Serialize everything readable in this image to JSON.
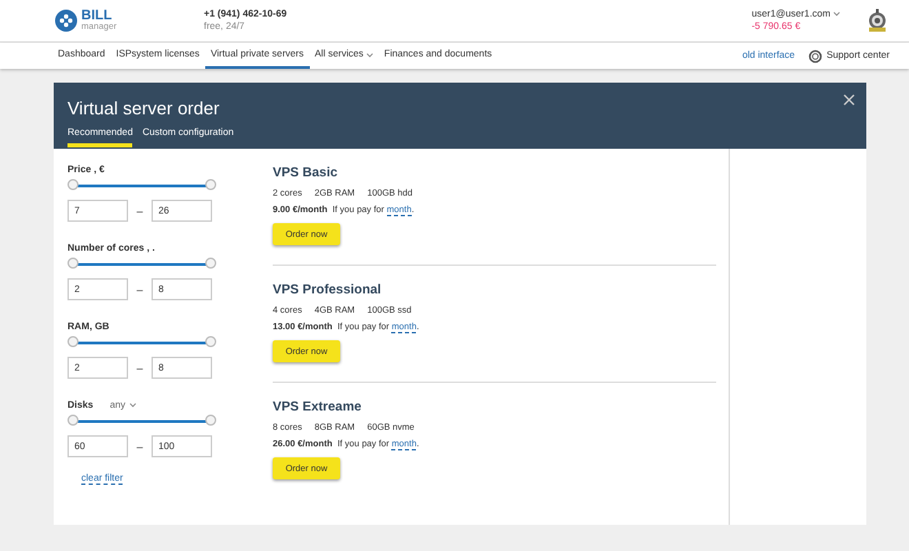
{
  "header": {
    "logo_text": "BILL",
    "logo_subtext": "manager",
    "phone": "+1 (941) 462-10-69",
    "phone_note": "free, 24/7",
    "user": "user1@user1.com",
    "balance": "-5 790.65 €"
  },
  "nav": {
    "items": [
      {
        "label": "Dashboard",
        "selected": false,
        "dropdown": false
      },
      {
        "label": "ISPsystem licenses",
        "selected": false,
        "dropdown": false
      },
      {
        "label": "Virtual private servers",
        "selected": true,
        "dropdown": false
      },
      {
        "label": "All services",
        "selected": false,
        "dropdown": true
      },
      {
        "label": "Finances and documents",
        "selected": false,
        "dropdown": false
      }
    ],
    "old_interface": "old interface",
    "support": "Support center"
  },
  "dialog": {
    "title": "Virtual server order",
    "tabs": [
      {
        "label": "Recommended",
        "selected": true
      },
      {
        "label": "Custom configuration",
        "selected": false
      }
    ],
    "filters": [
      {
        "label": "Price , €",
        "level": 1,
        "from": "7",
        "separator": "–",
        "to": "26"
      },
      {
        "label": "Number of cores , .",
        "level": 1,
        "from": "2",
        "separator": "–",
        "to": "8"
      },
      {
        "label": "RAM, GB",
        "level": 1,
        "from": "2",
        "separator": "–",
        "to": "8"
      },
      {
        "label": "Disks",
        "select": "any",
        "level": 1,
        "from": "60",
        "separator": "–",
        "to": "100"
      }
    ],
    "clear_filter": "clear filter",
    "plans": [
      {
        "name": "VPS Basic",
        "specs": [
          "2 cores",
          "2GB RAM",
          "100GB hdd"
        ],
        "price": "9.00 €/month",
        "note": "If you pay for",
        "period": "month",
        "note_end": ".",
        "button": "Order now"
      },
      {
        "name": "VPS Professional",
        "specs": [
          "4 cores",
          "4GB RAM",
          "100GB ssd"
        ],
        "price": "13.00 €/month",
        "note": "If you pay for",
        "period": "month",
        "note_end": ".",
        "button": "Order now"
      },
      {
        "name": "VPS Extreame",
        "specs": [
          "8 cores",
          "8GB RAM",
          "60GB nvme"
        ],
        "price": "26.00 €/month",
        "note": "If you pay for",
        "period": "month",
        "note_end": ".",
        "button": "Order now"
      }
    ]
  }
}
